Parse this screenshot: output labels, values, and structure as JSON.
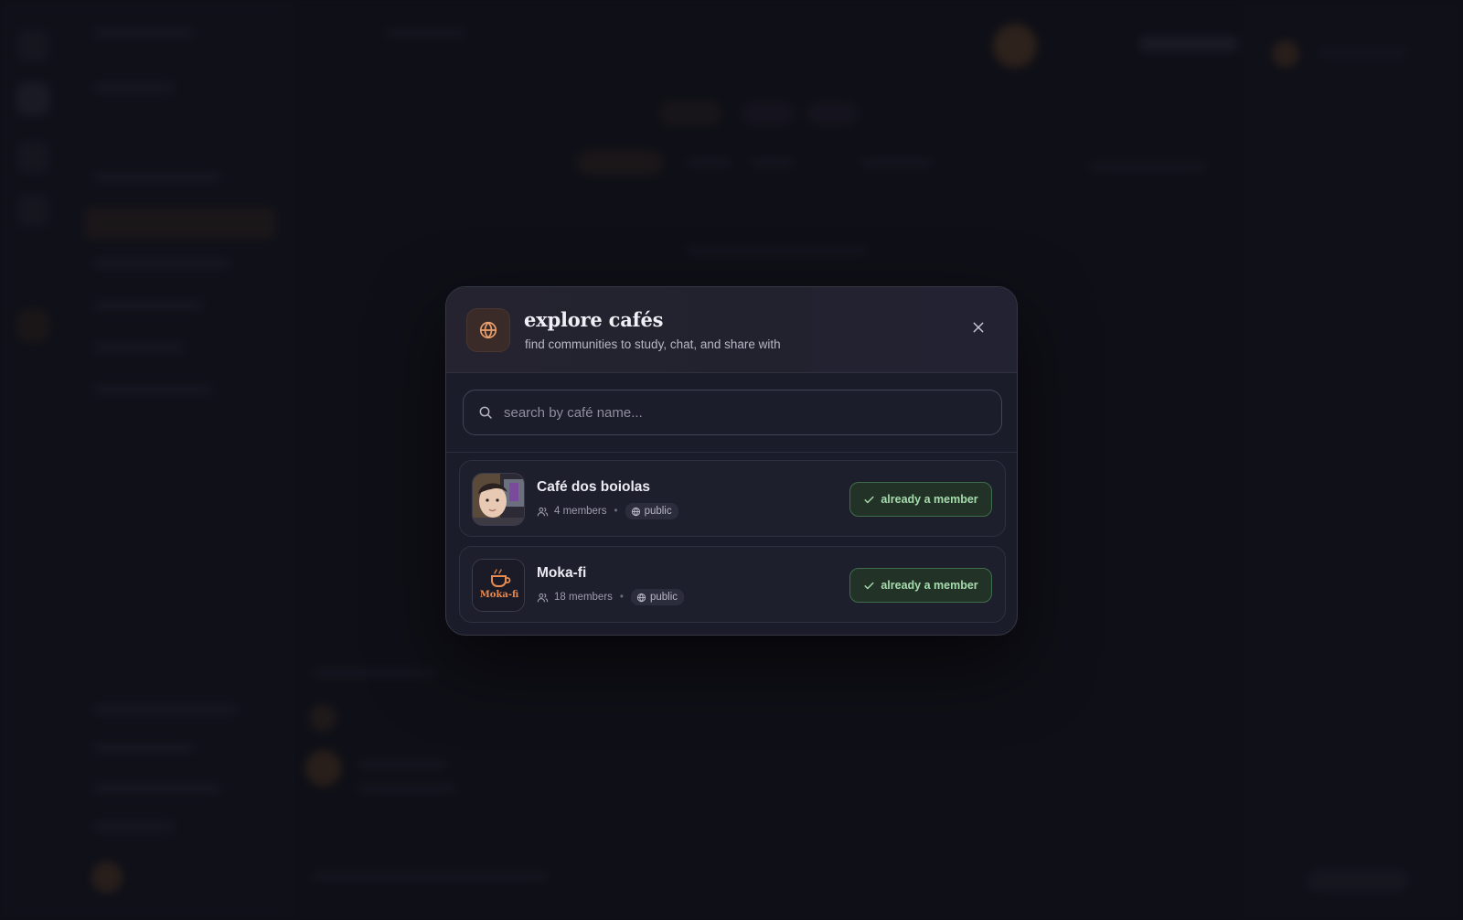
{
  "modal": {
    "title": "explore cafés",
    "subtitle": "find communities to study, chat, and share with",
    "icon": "globe-icon",
    "accent_color": "#e9a06e"
  },
  "search": {
    "placeholder": "search by café name...",
    "value": ""
  },
  "cafes": [
    {
      "name": "Café dos boiolas",
      "members": "4 members",
      "visibility": "public",
      "status": "already a member",
      "avatar": "photo"
    },
    {
      "name": "Moka-fi",
      "members": "18 members",
      "visibility": "public",
      "status": "already a member",
      "avatar": "Moka-fi",
      "avatar_color": "#e98a4e"
    }
  ],
  "colors": {
    "member_green": "#a6dcae",
    "background": "#14151f"
  }
}
